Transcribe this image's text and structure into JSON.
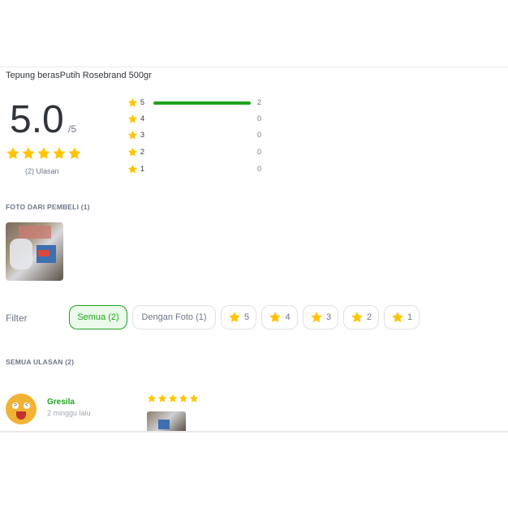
{
  "product": {
    "title": "Tepung berasPutih Rosebrand 500gr"
  },
  "summary": {
    "average": "5.0",
    "scale": "/5",
    "stars": 5,
    "review_count_label": "(2) Ulasan"
  },
  "distribution": [
    {
      "level": "5",
      "count": "2",
      "fraction": 1.0
    },
    {
      "level": "4",
      "count": "0",
      "fraction": 0
    },
    {
      "level": "3",
      "count": "0",
      "fraction": 0
    },
    {
      "level": "2",
      "count": "0",
      "fraction": 0
    },
    {
      "level": "1",
      "count": "0",
      "fraction": 0
    }
  ],
  "photos_section": {
    "title": "FOTO DARI PEMBELI (1)"
  },
  "filter": {
    "label": "Filter",
    "chips": [
      {
        "label": "Semua (2)",
        "active": true,
        "star": false
      },
      {
        "label": "Dengan Foto (1)",
        "active": false,
        "star": false
      },
      {
        "label": "5",
        "active": false,
        "star": true
      },
      {
        "label": "4",
        "active": false,
        "star": true
      },
      {
        "label": "3",
        "active": false,
        "star": true
      },
      {
        "label": "2",
        "active": false,
        "star": true
      },
      {
        "label": "1",
        "active": false,
        "star": true
      }
    ]
  },
  "reviews_section": {
    "title": "SEMUA ULASAN (2)"
  },
  "reviews": [
    {
      "name": "Gresila",
      "time": "2 minggu lalu",
      "stars": 5,
      "avatar_icon": "emoji-avatar-icon"
    }
  ],
  "colors": {
    "accent": "#1fa31f",
    "star": "#ffc400",
    "chip_active_bg": "#ebfaea"
  }
}
